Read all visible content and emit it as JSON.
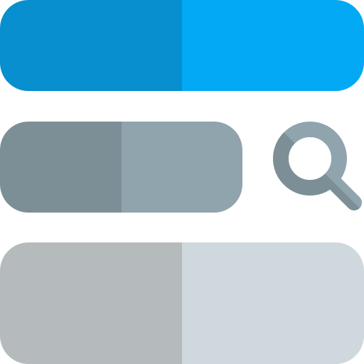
{
  "colors": {
    "top_bar_left": "#078fcf",
    "top_bar_right": "#03a9f4",
    "middle_bar_left": "#7d8f96",
    "middle_bar_right": "#90a4ae",
    "bottom_bar_left": "#b5bbbd",
    "bottom_bar_right": "#cfd8dc",
    "search_icon_light": "#90a4ae",
    "search_icon_dark": "#7d8f96"
  },
  "icons": {
    "magnifier": "search-icon"
  }
}
